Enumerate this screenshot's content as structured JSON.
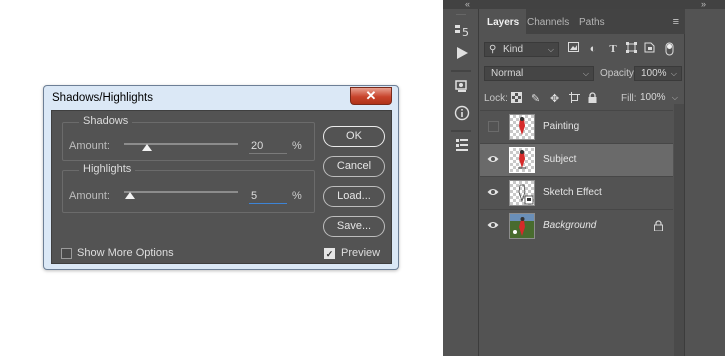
{
  "dialog": {
    "title": "Shadows/Highlights",
    "close_glyph": "✕",
    "shadows": {
      "legend": "Shadows",
      "amount_label": "Amount:",
      "amount_value": "20",
      "unit": "%",
      "level_percent": 20
    },
    "highlights": {
      "legend": "Highlights",
      "amount_label": "Amount:",
      "amount_value": "5",
      "unit": "%",
      "level_percent": 5
    },
    "buttons": {
      "ok": "OK",
      "cancel": "Cancel",
      "load": "Load...",
      "save": "Save..."
    },
    "show_more_options": {
      "label": "Show More Options",
      "checked": false
    },
    "preview": {
      "label": "Preview",
      "checked": true
    }
  },
  "layers_panel": {
    "tabs": [
      "Layers",
      "Channels",
      "Paths"
    ],
    "active_tab": "Layers",
    "filter": {
      "kind_label": "Kind",
      "icons": [
        "image-filter-icon",
        "adjustment-filter-icon",
        "type-filter-icon",
        "shape-filter-icon",
        "smart-object-filter-icon",
        "filter-toggle-icon"
      ]
    },
    "blend_mode": "Normal",
    "opacity_label": "Opacity:",
    "opacity_value": "100%",
    "lock_label": "Lock:",
    "fill_label": "Fill:",
    "fill_value": "100%",
    "layers": [
      {
        "name": "Painting",
        "visible": false,
        "selected": false,
        "italic": false,
        "locked": false
      },
      {
        "name": "Subject",
        "visible": true,
        "selected": true,
        "italic": false,
        "locked": false
      },
      {
        "name": "Sketch Effect",
        "visible": true,
        "selected": false,
        "italic": false,
        "locked": false
      },
      {
        "name": "Background",
        "visible": true,
        "selected": false,
        "italic": true,
        "locked": true
      }
    ]
  },
  "colors": {
    "panel_bg": "#535353",
    "dialog_frame": "#dbe8f6",
    "close_button": "#c8442c",
    "focus_underline": "#3d84d6",
    "selected_row": "#6a6a6a"
  }
}
